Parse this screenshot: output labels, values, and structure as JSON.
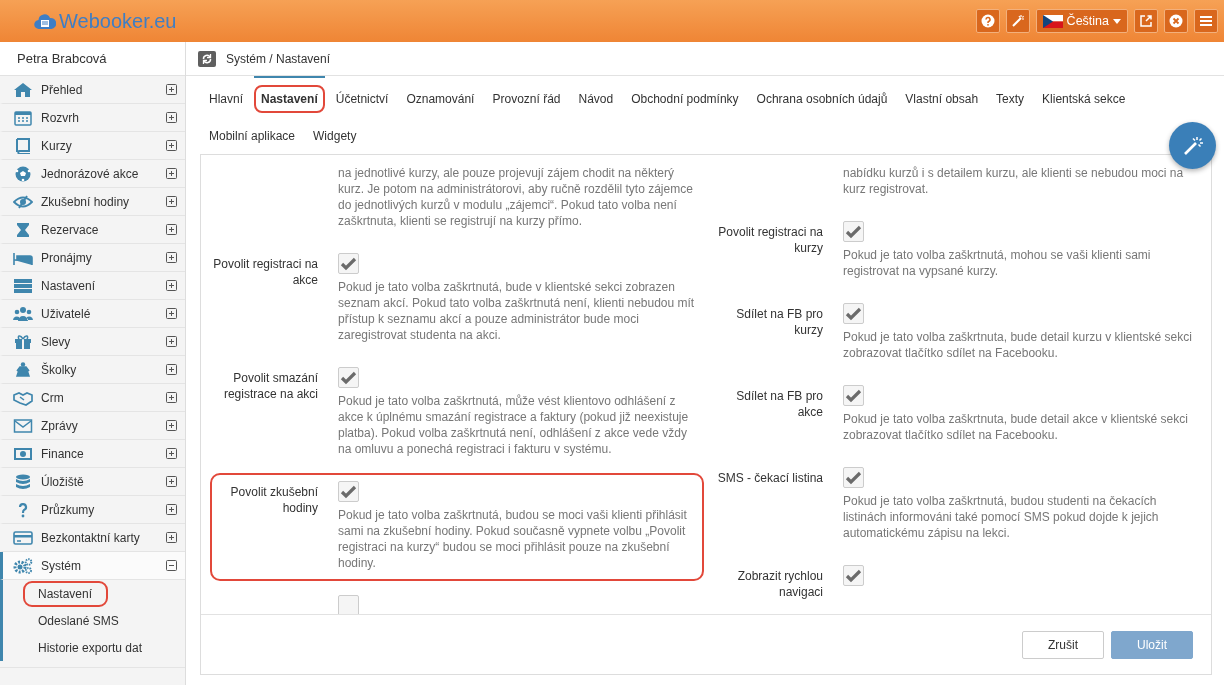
{
  "header": {
    "logo": "Webooker.eu",
    "language": "Čeština"
  },
  "sidebar": {
    "user": "Petra Brabcová",
    "items": [
      {
        "label": "Přehled",
        "expanded": false,
        "selected": false
      },
      {
        "label": "Rozvrh",
        "expanded": false,
        "selected": false
      },
      {
        "label": "Kurzy",
        "expanded": false,
        "selected": false
      },
      {
        "label": "Jednorázové akce",
        "expanded": false,
        "selected": false
      },
      {
        "label": "Zkušební hodiny",
        "expanded": false,
        "selected": false
      },
      {
        "label": "Rezervace",
        "expanded": false,
        "selected": false
      },
      {
        "label": "Pronájmy",
        "expanded": false,
        "selected": false
      },
      {
        "label": "Nastavení",
        "expanded": false,
        "selected": false
      },
      {
        "label": "Uživatelé",
        "expanded": false,
        "selected": false
      },
      {
        "label": "Slevy",
        "expanded": false,
        "selected": false
      },
      {
        "label": "Školky",
        "expanded": false,
        "selected": false
      },
      {
        "label": "Crm",
        "expanded": false,
        "selected": false
      },
      {
        "label": "Zprávy",
        "expanded": false,
        "selected": false
      },
      {
        "label": "Finance",
        "expanded": false,
        "selected": false
      },
      {
        "label": "Úložiště",
        "expanded": false,
        "selected": false
      },
      {
        "label": "Průzkumy",
        "expanded": false,
        "selected": false
      },
      {
        "label": "Bezkontaktní karty",
        "expanded": false,
        "selected": false
      },
      {
        "label": "Systém",
        "expanded": true,
        "selected": true,
        "children": [
          {
            "label": "Nastavení",
            "highlighted": true
          },
          {
            "label": "Odeslané SMS",
            "highlighted": false
          },
          {
            "label": "Historie exportu dat",
            "highlighted": false
          }
        ]
      }
    ]
  },
  "breadcrumb": "Systém / Nastavení",
  "tabs": [
    {
      "label": "Hlavní",
      "selected": false,
      "highlighted": false
    },
    {
      "label": "Nastavení",
      "selected": true,
      "highlighted": true
    },
    {
      "label": "Účetnictví",
      "selected": false,
      "highlighted": false
    },
    {
      "label": "Oznamování",
      "selected": false,
      "highlighted": false
    },
    {
      "label": "Provozní řád",
      "selected": false,
      "highlighted": false
    },
    {
      "label": "Návod",
      "selected": false,
      "highlighted": false
    },
    {
      "label": "Obchodní podmínky",
      "selected": false,
      "highlighted": false
    },
    {
      "label": "Ochrana osobních údajů",
      "selected": false,
      "highlighted": false
    },
    {
      "label": "Vlastní obsah",
      "selected": false,
      "highlighted": false
    },
    {
      "label": "Texty",
      "selected": false,
      "highlighted": false
    },
    {
      "label": "Klientská sekce",
      "selected": false,
      "highlighted": false
    },
    {
      "label": "Mobilní aplikace",
      "selected": false,
      "highlighted": false
    },
    {
      "label": "Widgety",
      "selected": false,
      "highlighted": false
    }
  ],
  "settings": {
    "left": [
      {
        "kind": "continued",
        "description": "na jednotlivé kurzy, ale pouze projevují zájem chodit na některý kurz. Je potom na administrátorovi, aby ručně rozdělil tyto zájemce do jednotlivých kurzů v modulu „zájemci“. Pokud tato volba není zaškrtnuta, klienti se registrují na kurzy přímo."
      },
      {
        "kind": "option",
        "label": "Povolit registraci na akce",
        "checked": true,
        "highlighted": false,
        "description": "Pokud je tato volba zaškrtnutá, bude v klientské sekci zobrazen seznam akcí. Pokud tato volba zaškrtnutá není, klienti nebudou mít přístup k seznamu akcí a pouze administrátor bude moci zaregistrovat studenta na akci."
      },
      {
        "kind": "option",
        "label": "Povolit smazání registrace na akci",
        "checked": true,
        "highlighted": false,
        "description": "Pokud je tato volba zaškrtnutá, může vést klientovo odhlášení z akce k úplnému smazání registrace a faktury (pokud již neexistuje platba). Pokud volba zaškrtnutá není, odhlášení z akce vede vždy na omluvu a ponechá registraci i fakturu v systému."
      },
      {
        "kind": "option",
        "label": "Povolit zkušební hodiny",
        "checked": true,
        "highlighted": true,
        "description": "Pokud je tato volba zaškrtnutá, budou se moci vaši klienti přihlásit sami na zkušební hodiny. Pokud současně vypnete volbu „Povolit registraci na kurzy“ budou se moci přihlásit pouze na zkušební hodiny."
      },
      {
        "kind": "option",
        "checked": false,
        "highlighted": false
      }
    ],
    "right": [
      {
        "kind": "continued",
        "description": "nabídku kurzů i s detailem kurzu, ale klienti se nebudou moci na kurz registrovat."
      },
      {
        "kind": "option",
        "label": "Povolit registraci na kurzy",
        "checked": true,
        "highlighted": false,
        "description": "Pokud je tato volba zaškrtnutá, mohou se vaši klienti sami registrovat na vypsané kurzy."
      },
      {
        "kind": "option",
        "label": "Sdílet na FB pro kurzy",
        "checked": true,
        "highlighted": false,
        "description": "Pokud je tato volba zaškrtnuta, bude detail kurzu v klientské sekci zobrazovat tlačítko sdílet na Facebooku."
      },
      {
        "kind": "option",
        "label": "Sdílet na FB pro akce",
        "checked": true,
        "highlighted": false,
        "description": "Pokud je tato volba zaškrtnuta, bude detail akce v klientské sekci zobrazovat tlačítko sdílet na Facebooku."
      },
      {
        "kind": "option",
        "label": "SMS - čekací listina",
        "checked": true,
        "highlighted": false,
        "description": "Pokud je tato volba zaškrtnutá, budou studenti na čekacích listinách informováni také pomocí SMS pokud dojde k jejich automatickému zápisu na lekci."
      },
      {
        "kind": "option",
        "label": "Zobrazit rychlou navigaci",
        "checked": true,
        "highlighted": false
      }
    ]
  },
  "buttons": [
    {
      "label": "Zrušit",
      "kind": "cancel"
    },
    {
      "label": "Uložit",
      "kind": "save"
    }
  ]
}
